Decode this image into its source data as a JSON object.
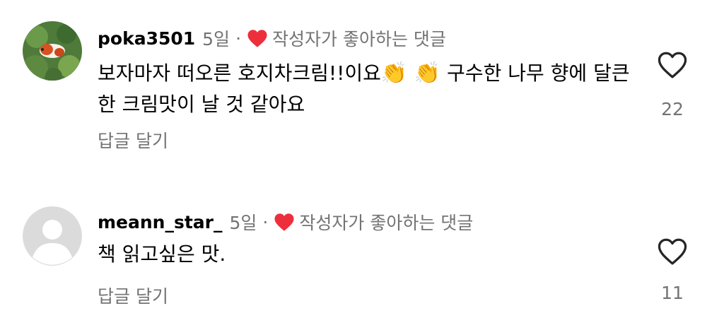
{
  "comments": [
    {
      "username": "poka3501",
      "age": "5일",
      "separator": "·",
      "liked_by_author": "작성자가 좋아하는 댓글",
      "text_part1": "보자마자 떠오른 호지차크림!!이요",
      "emoji": "👏 👏",
      "text_part2": " 구수한 나무 향에 달큰한 크림맛이 날 것 같아요",
      "reply_label": "답글 달기",
      "like_count": "22",
      "avatar_icon": "photo-avatar"
    },
    {
      "username": "meann_star_",
      "age": "5일",
      "separator": "·",
      "liked_by_author": "작성자가 좋아하는 댓글",
      "text": "책 읽고싶은 맛.",
      "reply_label": "답글 달기",
      "like_count": "11",
      "avatar_icon": "default-avatar"
    }
  ],
  "colors": {
    "heart_red": "#ed2f3c",
    "meta_gray": "#737373",
    "avatar_gray": "#dbdbdb"
  }
}
